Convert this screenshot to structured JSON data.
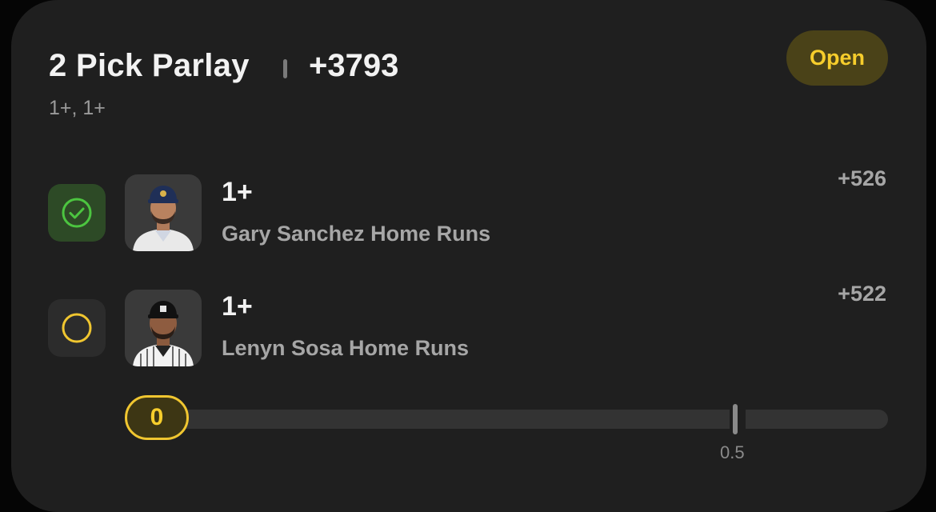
{
  "parlay": {
    "title": "2 Pick Parlay",
    "odds": "+3793",
    "subtitle": "1+, 1+",
    "status": "Open"
  },
  "legs": [
    {
      "line": "1+",
      "market": "Gary Sanchez Home Runs",
      "odds": "+526",
      "status": "won",
      "status_icon": "check-circle-icon",
      "status_color": "#4cc540",
      "cap_color": "#1f2f57"
    },
    {
      "line": "1+",
      "market": "Lenyn Sosa Home Runs",
      "odds": "+522",
      "status": "pending",
      "status_icon": "empty-circle-icon",
      "status_color": "#f0c630",
      "cap_color": "#111111"
    }
  ],
  "progress": {
    "current_value": "0",
    "threshold_label": "0.5",
    "current": 0,
    "threshold": 0.5
  },
  "colors": {
    "accent_yellow": "#f6cd2c",
    "success_green": "#4cc540",
    "card_bg": "#1f1f1f"
  }
}
